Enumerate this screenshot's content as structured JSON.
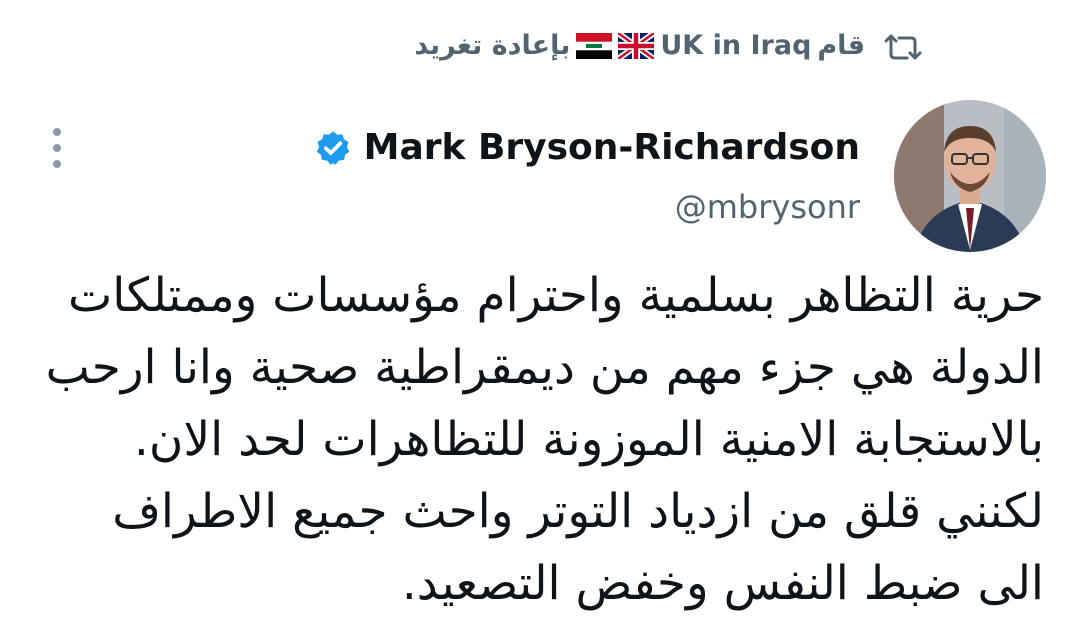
{
  "retweet": {
    "prefix": "قام",
    "account_name": "UK in Iraq",
    "suffix": "بإعادة تغريد",
    "icon": "retweet-icon",
    "flags": [
      "uk-flag",
      "iraq-flag"
    ]
  },
  "author": {
    "display_name": "Mark Bryson-Richardson",
    "handle": "@mbrysonr",
    "verified": true
  },
  "tweet": {
    "text": "حرية التظاهر بسلمية واحترام مؤسسات وممتلكات الدولة هي جزء مهم من ديمقراطية صحية وانا ارحب بالاستجابة الامنية الموزونة للتظاهرات لحد الان. لكنني قلق من ازدياد التوتر واحث جميع الاطراف الى ضبط النفس وخفض التصعيد."
  },
  "colors": {
    "verified_blue": "#1d9bf0",
    "secondary_text": "#536471",
    "primary_text": "#0f1419"
  }
}
